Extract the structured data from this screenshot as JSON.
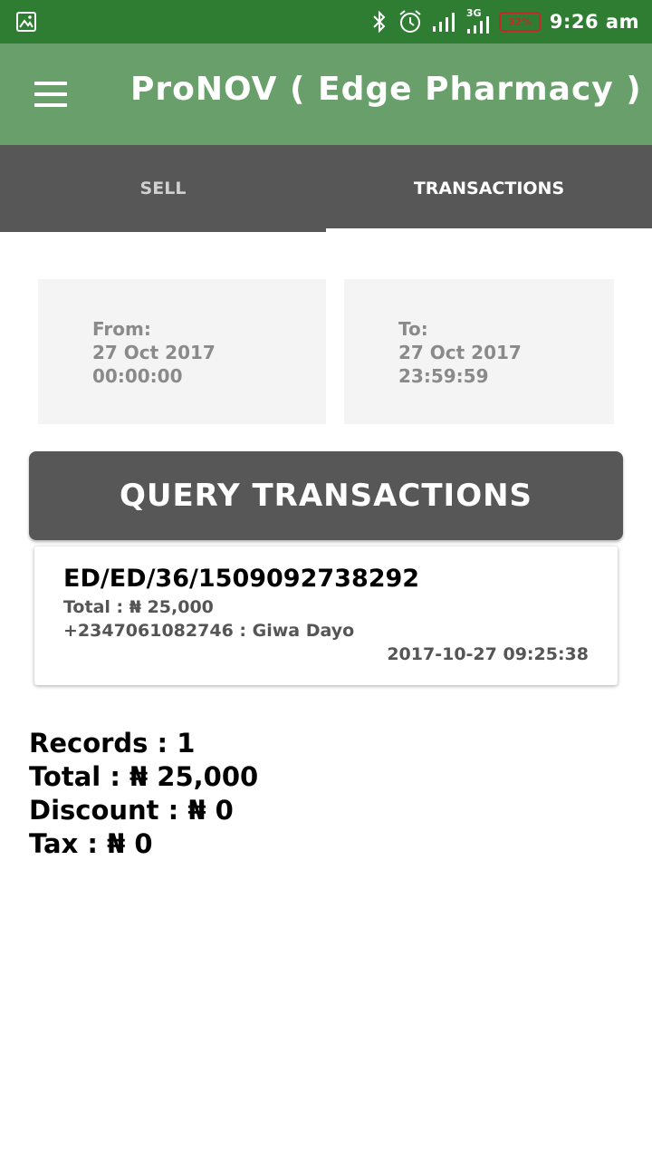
{
  "status_bar": {
    "time": "9:26 am",
    "battery": "32%",
    "network_type": "3G",
    "icons": [
      "image-icon",
      "bluetooth-icon",
      "alarm-icon",
      "signal-icon",
      "signal-3g-icon",
      "battery-icon"
    ],
    "colors": {
      "background": "#2e7d32",
      "battery_low": "#c62828"
    }
  },
  "app_bar": {
    "title": "ProNOV ( Edge Pharmacy )",
    "menu_icon": "hamburger-menu-icon",
    "color": "#689f6a"
  },
  "tabs": [
    {
      "label": "SELL",
      "active": false
    },
    {
      "label": "TRANSACTIONS",
      "active": true
    }
  ],
  "date_range": {
    "from": {
      "label": "From:",
      "date": "27 Oct 2017",
      "time": "00:00:00"
    },
    "to": {
      "label": "To:",
      "date": "27 Oct 2017",
      "time": "23:59:59"
    }
  },
  "query_button": {
    "label": "QUERY TRANSACTIONS"
  },
  "transactions": [
    {
      "id": "ED/ED/36/1509092738292",
      "total": "Total : ₦ 25,000",
      "customer": "+2347061082746 : Giwa Dayo",
      "datetime": "2017-10-27 09:25:38"
    }
  ],
  "summary": {
    "records": "Records : 1",
    "total": "Total : ₦ 25,000",
    "discount": "Discount : ₦ 0",
    "tax": "Tax : ₦ 0"
  }
}
